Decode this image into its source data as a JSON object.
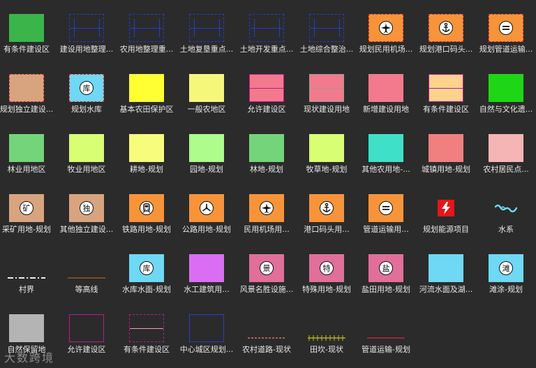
{
  "rows": [
    [
      {
        "label": "有条件建设区",
        "style": "fill",
        "color": "#3bb54a"
      },
      {
        "label": "建设用地整理...",
        "style": "outline-blue"
      },
      {
        "label": "农用地整理重...",
        "style": "outline-blue"
      },
      {
        "label": "土地复垦重点...",
        "style": "outline-blue"
      },
      {
        "label": "土地开发重点...",
        "style": "outline-blue"
      },
      {
        "label": "土地综合整治...",
        "style": "outline-blue"
      },
      {
        "label": "规划民用机场...",
        "style": "fill-dash",
        "color": "#f7943a",
        "icon": "airplane-icon"
      },
      {
        "label": "规划港口码头...",
        "style": "fill-dash",
        "color": "#f7943a",
        "icon": "anchor-icon"
      },
      {
        "label": "规划管道运输...",
        "style": "fill-dash",
        "color": "#f7943a",
        "icon": "pipeline-icon"
      }
    ],
    [
      {
        "label": "规划独立建设...",
        "style": "fill-dash",
        "color": "#d8a47f"
      },
      {
        "label": "规划水库",
        "style": "fill-dash",
        "color": "#6ed8f5",
        "icon": "reservoir-icon",
        "badge": "库"
      },
      {
        "label": "基本农田保护区",
        "style": "fill",
        "color": "#ffff33"
      },
      {
        "label": "一般农地区",
        "style": "fill",
        "color": "#f5f77a"
      },
      {
        "label": "允许建设区",
        "style": "fill-line",
        "color": "#f27a8c",
        "line": "#c2188f"
      },
      {
        "label": "现状建设用地",
        "style": "fill-line",
        "color": "#f27a8c",
        "line": "#9b9b9b"
      },
      {
        "label": "新增建设用地",
        "style": "fill",
        "color": "#f27a8c"
      },
      {
        "label": "有条件建设区",
        "style": "fill-line",
        "color": "#fcd38c",
        "line": "#c2188f"
      },
      {
        "label": "自然与文化遗...",
        "style": "fill",
        "color": "#1fd616"
      }
    ],
    [
      {
        "label": "林业用地区",
        "style": "fill",
        "color": "#73d47a"
      },
      {
        "label": "牧业用地区",
        "style": "fill",
        "color": "#d8ff73"
      },
      {
        "label": "耕地-规划",
        "style": "fill",
        "color": "#f7fc7c"
      },
      {
        "label": "园地-规划",
        "style": "fill",
        "color": "#adfc8c"
      },
      {
        "label": "林地-规划",
        "style": "fill",
        "color": "#73d47a"
      },
      {
        "label": "牧草地-规划",
        "style": "fill",
        "color": "#d8ff73"
      },
      {
        "label": "其他农用地-...",
        "style": "fill",
        "color": "#3fe0c8"
      },
      {
        "label": "城镇用地-规划",
        "style": "fill",
        "color": "#f07f7f"
      },
      {
        "label": "农村居民点...",
        "style": "fill",
        "color": "#f5b5b5"
      }
    ],
    [
      {
        "label": "采矿用地-规划",
        "style": "fill",
        "color": "#d8a47f",
        "icon": "mine-icon",
        "badge": "矿"
      },
      {
        "label": "其他独立建设...",
        "style": "fill",
        "color": "#d8a47f",
        "icon": "independent-icon",
        "badge": "独"
      },
      {
        "label": "铁路用地-规划",
        "style": "fill",
        "color": "#f7943a",
        "icon": "train-icon"
      },
      {
        "label": "公路用地-规划",
        "style": "fill",
        "color": "#f7943a",
        "icon": "road-icon"
      },
      {
        "label": "民用机场用...",
        "style": "fill",
        "color": "#f7943a",
        "icon": "airplane-icon"
      },
      {
        "label": "港口码头用...",
        "style": "fill",
        "color": "#f7943a",
        "icon": "anchor-icon"
      },
      {
        "label": "管道运输用...",
        "style": "fill",
        "color": "#f7943a",
        "icon": "pipeline-icon"
      },
      {
        "label": "规划能源项目",
        "style": "energy",
        "icon": "lightning-icon"
      },
      {
        "label": "水系",
        "style": "water",
        "icon": "water-icon"
      }
    ],
    [
      {
        "label": "村界",
        "style": "line-village"
      },
      {
        "label": "等高线",
        "style": "line-contour"
      },
      {
        "label": "水库水面-规划",
        "style": "fill",
        "color": "#6ed8f5",
        "icon": "reservoir-icon",
        "badge": "库"
      },
      {
        "label": "水工建筑用...",
        "style": "fill",
        "color": "#d96ef5"
      },
      {
        "label": "风景名胜设施...",
        "style": "fill",
        "color": "#e06f99",
        "icon": "scenic-icon",
        "badge": "景"
      },
      {
        "label": "特殊用地-规划",
        "style": "fill",
        "color": "#e06f99",
        "icon": "special-icon",
        "badge": "特"
      },
      {
        "label": "盐田用地-规划",
        "style": "fill",
        "color": "#e06f99",
        "icon": "salt-icon",
        "badge": "盐"
      },
      {
        "label": "河流水面及湖...",
        "style": "fill",
        "color": "#6ed8f5"
      },
      {
        "label": "滩涂-规划",
        "style": "fill",
        "color": "#6ed8f5",
        "icon": "mudflat-icon",
        "badge": "滩"
      }
    ],
    [
      {
        "label": "自然保留地",
        "style": "fill",
        "color": "#b4b4b4"
      },
      {
        "label": "允许建设区",
        "style": "outline-magenta"
      },
      {
        "label": "有条件建设区",
        "style": "outline-magenta-line"
      },
      {
        "label": "中心城区规划...",
        "style": "outline-blue-solid"
      },
      {
        "label": "农村道路-现状",
        "style": "line-rural"
      },
      {
        "label": "田坎-现状",
        "style": "line-ridge"
      },
      {
        "label": "管道运输-规划",
        "style": "line-pipe"
      }
    ]
  ],
  "watermark": "大数跨境"
}
